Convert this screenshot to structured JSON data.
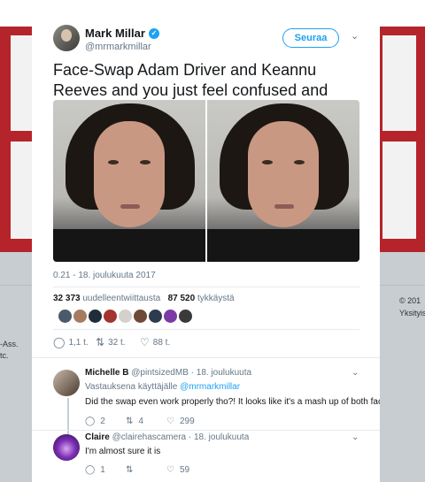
{
  "tweet": {
    "author_name": "Mark Millar",
    "author_handle": "@mrmarkmillar",
    "follow_label": "Seuraa",
    "text": "Face-Swap Adam Driver and Keannu Reeves and you just feel confused and slightly lost...",
    "timestamp": "0.21 - 18. joulukuuta 2017",
    "retweet_count": "32 373",
    "retweet_label": "uudelleentwiittausta",
    "like_count": "87 520",
    "like_label": "tykkäystä",
    "actions": {
      "reply": "1,1 t.",
      "retweet": "32 t.",
      "like": "88 t."
    }
  },
  "replies": [
    {
      "name": "Michelle B",
      "handle": "@pintsizedMB",
      "date": "· 18. joulukuuta",
      "reply_prefix": "Vastauksena käyttäjälle",
      "reply_to": "@mrmarkmillar",
      "text": "Did the swap even work properly tho?! It looks like it's a mash up of both faces",
      "counts": {
        "reply": "2",
        "retweet": "4",
        "like": "299"
      }
    },
    {
      "name": "Claire",
      "handle": "@clairehascamera",
      "date": "· 18. joulukuuta",
      "text": "I'm almost sure it is",
      "counts": {
        "reply": "1",
        "retweet": "",
        "like": "59"
      }
    }
  ],
  "background": {
    "left_text_1": "-Ass.",
    "left_text_2": "tc.",
    "right_text_1": "© 201",
    "right_text_2": "Yksityisy"
  },
  "colors": {
    "accent": "#1da1f2",
    "backdrop_red": "#b5242b",
    "like_red": "#e0245e",
    "retweet_green": "#17bf63"
  }
}
